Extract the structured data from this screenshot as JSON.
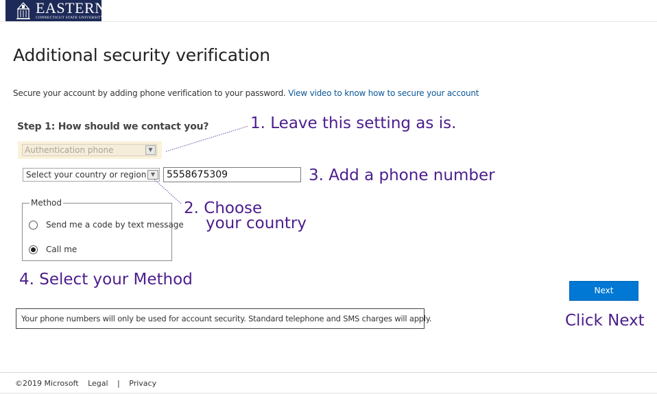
{
  "header": {
    "logo_name": "EASTERN",
    "logo_sub": "CONNECTICUT STATE UNIVERSITY"
  },
  "page": {
    "title": "Additional security verification",
    "intro": "Secure your account by adding phone verification to your password.",
    "video_link": "View video to know how to secure your account",
    "step_title": "Step 1: How should we contact you?"
  },
  "form": {
    "auth_method": "Authentication phone",
    "country_placeholder": "Select your country or region",
    "phone_value": "5558675309",
    "method_legend": "Method",
    "options": [
      {
        "label": "Send me a code by text message",
        "selected": false
      },
      {
        "label": "Call me",
        "selected": true
      }
    ],
    "next_label": "Next",
    "note": "Your phone numbers will only be used for account security. Standard telephone and SMS charges will apply."
  },
  "annotations": {
    "a1": "1. Leave this setting as is.",
    "a2_line1": "2. Choose",
    "a2_line2": "your country",
    "a3": "3. Add a phone number",
    "a4": "4. Select your Method",
    "a5": "Click Next",
    "color": "#4b1d8c"
  },
  "footer": {
    "copyright": "©2019 Microsoft",
    "legal": "Legal",
    "separator": "|",
    "privacy": "Privacy"
  }
}
